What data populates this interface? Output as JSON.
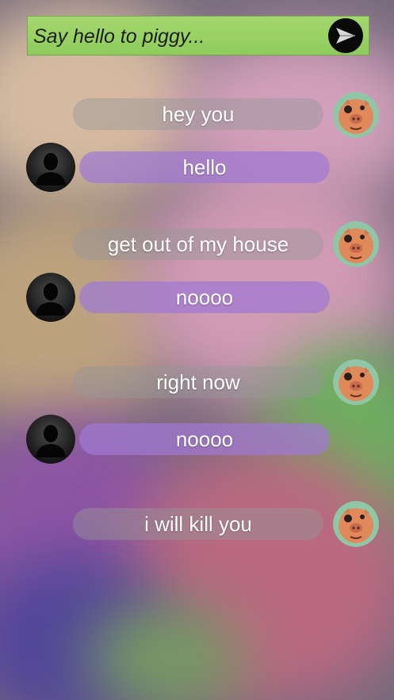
{
  "input": {
    "placeholder": "Say hello to piggy..."
  },
  "send": {
    "icon": "send-arrow-icon"
  },
  "messages": [
    {
      "from": "piggy",
      "text": "hey you"
    },
    {
      "from": "user",
      "text": "hello"
    },
    {
      "from": "piggy",
      "text": "get out of my house"
    },
    {
      "from": "user",
      "text": "noooo"
    },
    {
      "from": "piggy",
      "text": "right now"
    },
    {
      "from": "user",
      "text": "noooo"
    },
    {
      "from": "piggy",
      "text": "i will kill you"
    }
  ],
  "avatars": {
    "piggy": "piggy-avatar-icon",
    "user": "user-silhouette-icon"
  }
}
